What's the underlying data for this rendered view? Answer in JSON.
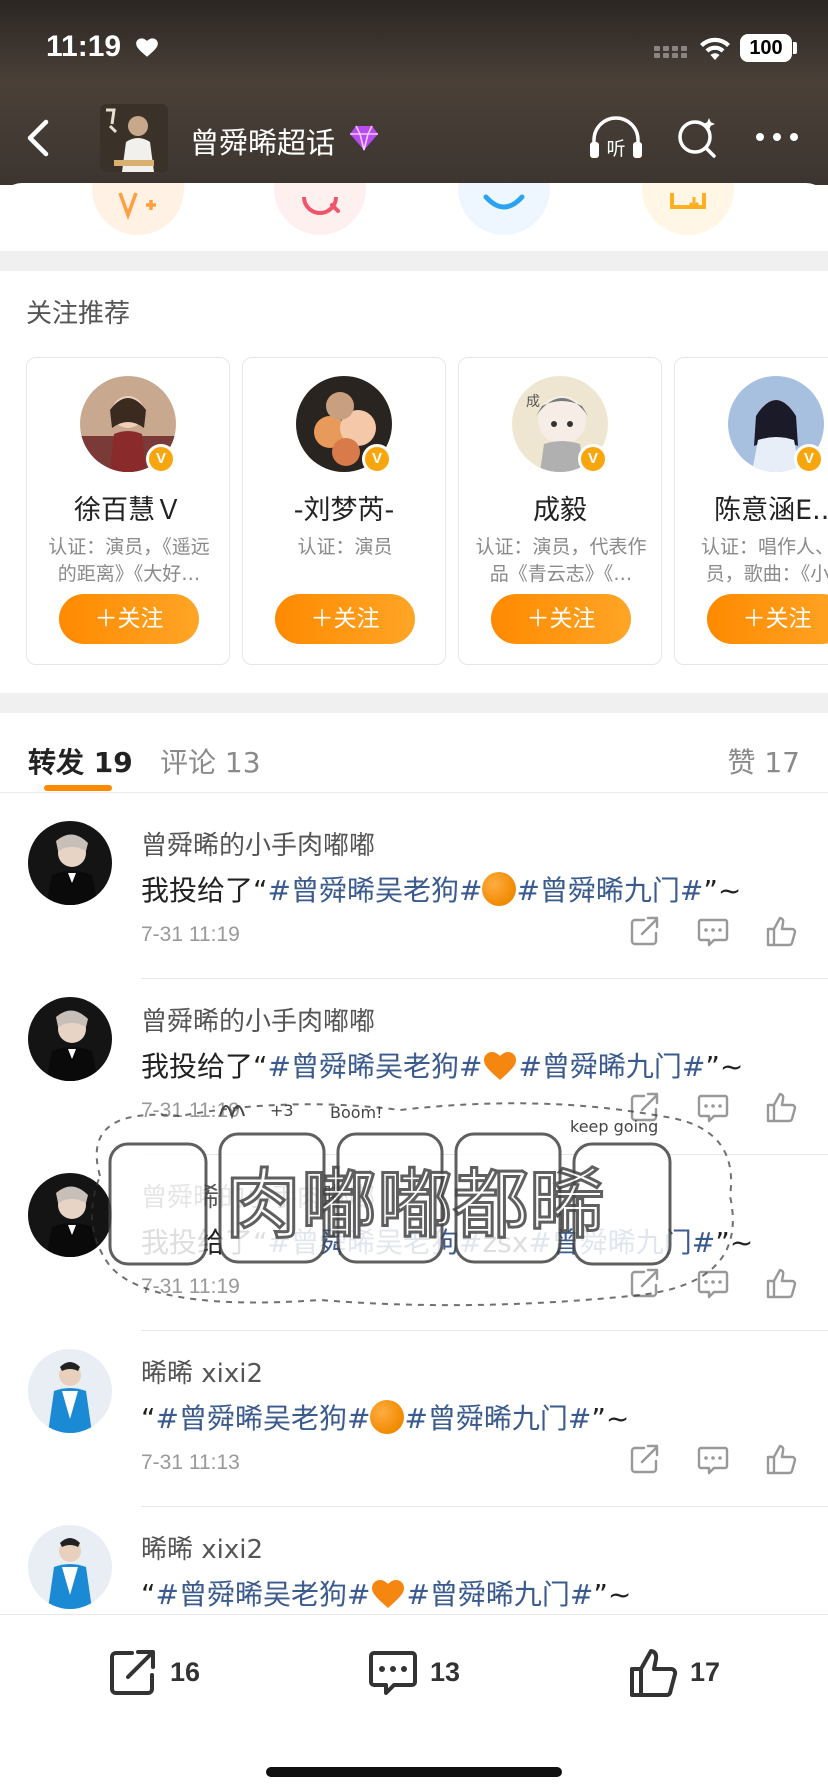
{
  "status": {
    "time": "11:19",
    "battery": "100"
  },
  "nav": {
    "title": "曾舜晞超话"
  },
  "recommend": {
    "title": "关注推荐",
    "users": [
      {
        "name": "徐百慧Ｖ",
        "desc": "认证：演员，《遥远的距离》《大好…",
        "follow": "＋关注",
        "avatar_color": "#c4736a"
      },
      {
        "name": "-刘梦芮-",
        "desc": "认证：演员",
        "follow": "＋关注",
        "avatar_color": "#d89a60"
      },
      {
        "name": "成毅",
        "desc": "认证：演员，代表作品《青云志》《…",
        "follow": "＋关注",
        "avatar_color": "#d8d0c0"
      },
      {
        "name": "陈意涵E...",
        "desc": "认证：唱作人、演员，歌曲：《小…",
        "follow": "＋关注",
        "avatar_color": "#b8c8e8"
      }
    ]
  },
  "tabs": {
    "repost": "转发 19",
    "comment": "评论 13",
    "likes": "赞 17"
  },
  "feed": [
    {
      "name": "曾舜晞的小手肉嘟嘟",
      "prefix": "我投给了“",
      "tag1": "#曾舜晞吴老狗#",
      "emoji": "orange-circle",
      "tag2": "#曾舜晞九门#",
      "suffix": "”~",
      "time": "7-31 11:19"
    },
    {
      "name": "曾舜晞的小手肉嘟嘟",
      "prefix": "我投给了“",
      "tag1": "#曾舜晞吴老狗#",
      "emoji": "orange-heart",
      "tag2": "#曾舜晞九门#",
      "suffix": "”~",
      "time": "7-31 11:19"
    },
    {
      "name": "曾舜晞的小手肉嘟嘟",
      "prefix": "我投给了“",
      "tag1": "#曾舜晞吴老狗#",
      "middle": "zsx",
      "tag2": "#曾舜晞九门#",
      "suffix": "”~",
      "time": "7-31 11:19"
    },
    {
      "name": "晞晞 xixi2",
      "prefix": "“",
      "tag1": "#曾舜晞吴老狗#",
      "emoji": "orange-circle",
      "tag2": "#曾舜晞九门#",
      "suffix": "”~",
      "time": "7-31 11:13"
    },
    {
      "name": "晞晞 xixi2",
      "prefix": "“",
      "tag1": "#曾舜晞吴老狗#",
      "emoji": "orange-heart",
      "tag2": "#曾舜晞九门#",
      "suffix": "”~",
      "time": ""
    }
  ],
  "watermark": {
    "text": "肉嘟嘟都晞",
    "doodles": [
      "Boom!",
      "keep going",
      "+3"
    ]
  },
  "bottombar": {
    "repost_count": "16",
    "comment_count": "13",
    "like_count": "17"
  },
  "colors": {
    "accent": "#ff8a00",
    "tag": "#3b5b8f",
    "verified": "#f7a70d"
  }
}
